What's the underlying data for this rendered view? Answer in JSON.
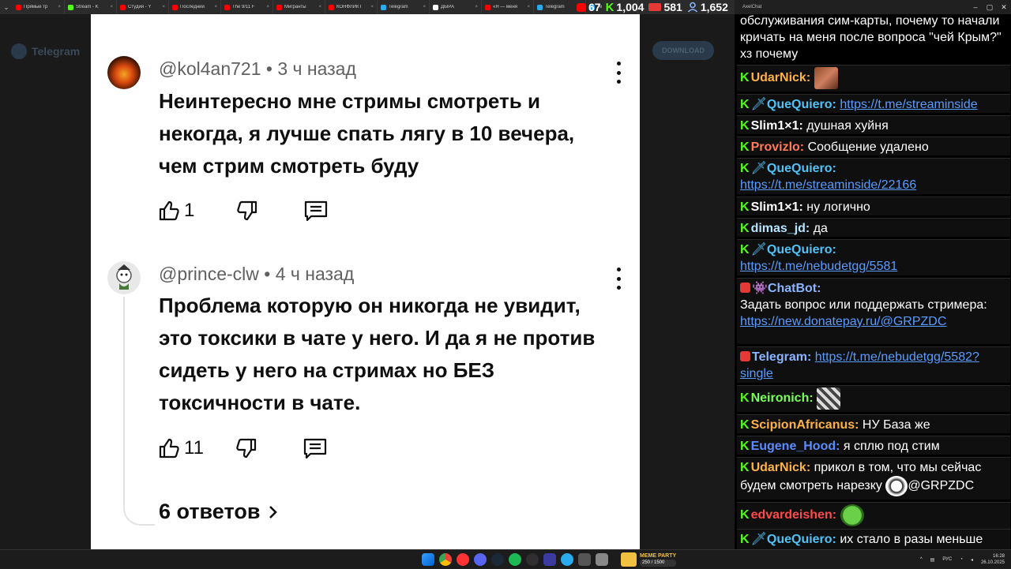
{
  "browser": {
    "tabs": [
      {
        "title": "Прямые тр",
        "color": "#ff0000"
      },
      {
        "title": "Stream - K",
        "color": "#53fc18"
      },
      {
        "title": "Студия - Y",
        "color": "#ff0000"
      },
      {
        "title": "Последний",
        "color": "#ff0000"
      },
      {
        "title": "The 9/11 F",
        "color": "#ff0000"
      },
      {
        "title": "Мигранты",
        "color": "#ff0000"
      },
      {
        "title": "КОНФЛИКТ",
        "color": "#ff0000"
      },
      {
        "title": "Telegram",
        "color": "#2aabee"
      },
      {
        "title": "ДЫРА",
        "color": "#ffffff"
      },
      {
        "title": "«Я — меня",
        "color": "#ff0000"
      },
      {
        "title": "Telegram",
        "color": "#2aabee"
      },
      {
        "title": "Te",
        "color": "#2aabee"
      }
    ]
  },
  "stats": {
    "youtube_viewers": "67",
    "kick_viewers": "1,004",
    "vk_viewers": "581",
    "total_viewers": "1,652"
  },
  "chat_window": {
    "title": "AxelChat"
  },
  "background_app": {
    "name": "Telegram",
    "download_label": "DOWNLOAD"
  },
  "comments": [
    {
      "username": "@kol4an721",
      "time": "3 ч назад",
      "text": "Неинтересно мне стримы смотреть и некогда, я лучше спать лягу в 10 вечера, чем стрим смотреть буду",
      "likes": "1"
    },
    {
      "username": "@prince-clw",
      "time": "4 ч назад",
      "text": "Проблема которую он никогда не увидит, это токсики в чате у него. И да я не против сидеть у него на стримах но БЕЗ токсичности в чате.",
      "likes": "11",
      "replies_label": "6 ответов"
    }
  ],
  "chat": {
    "messages": [
      {
        "user": "",
        "text": "обслуживания сим-карты, почему то начали кричать на меня после вопроса \"чей Крым?\" хз почему"
      },
      {
        "user": "UdarNick:",
        "text": "",
        "color": "#ffb347"
      },
      {
        "user": "QueQuiero:",
        "text": "https://t.me/streaminside",
        "color": "#4fc3f7"
      },
      {
        "user": "Slim1×1:",
        "text": "душная хуйня",
        "color": "#ffffff"
      },
      {
        "user": "Provizlo:",
        "text": "Сообщение удалено",
        "color": "#ff7b5a"
      },
      {
        "user": "QueQuiero:",
        "text": "https://t.me/streaminside/22166",
        "color": "#4fc3f7"
      },
      {
        "user": "Slim1×1:",
        "text": "ну логично",
        "color": "#ffffff"
      },
      {
        "user": "dimas_jd:",
        "text": "да",
        "color": "#b6e3ff"
      },
      {
        "user": "QueQuiero:",
        "text": "https://t.me/nebudetgg/5581",
        "color": "#4fc3f7"
      },
      {
        "user": "ChatBot:",
        "text": "Задать вопрос или поддержать стримера: ",
        "link": "https://new.donatepay.ru/@GRPZDC",
        "color": "#8ab4ff"
      },
      {
        "user": "Telegram:",
        "text": "https://t.me/nebudetgg/5582?single",
        "color": "#8ab4ff"
      },
      {
        "user": "Neironich:",
        "text": "",
        "color": "#7cfc5a"
      },
      {
        "user": "ScipionAfricanus:",
        "text": "НУ База же",
        "color": "#ffb347"
      },
      {
        "user": "Eugene_Hood:",
        "text": "я сплю под стим",
        "color": "#5a8cff"
      },
      {
        "user": "UdarNick:",
        "text": "прикол в том, что мы сейчас будем смотреть нарезку ",
        "mention": "@GRPZDC",
        "color": "#ffb347"
      },
      {
        "user": "edvardeishen:",
        "text": "",
        "color": "#ff4a4a"
      },
      {
        "user": "QueQuiero:",
        "text": "их стало в разы меньше",
        "color": "#4fc3f7"
      }
    ]
  },
  "taskbar": {
    "meme_widget_label": "MEME PARTY",
    "meme_widget_value": "250 / 1500",
    "language": "РУС",
    "time": "16:28",
    "date": "26.10.2025"
  },
  "colors": {
    "kick_green": "#53fc18",
    "link_blue": "#5a9cff",
    "panel_bg": "#ffffff"
  }
}
